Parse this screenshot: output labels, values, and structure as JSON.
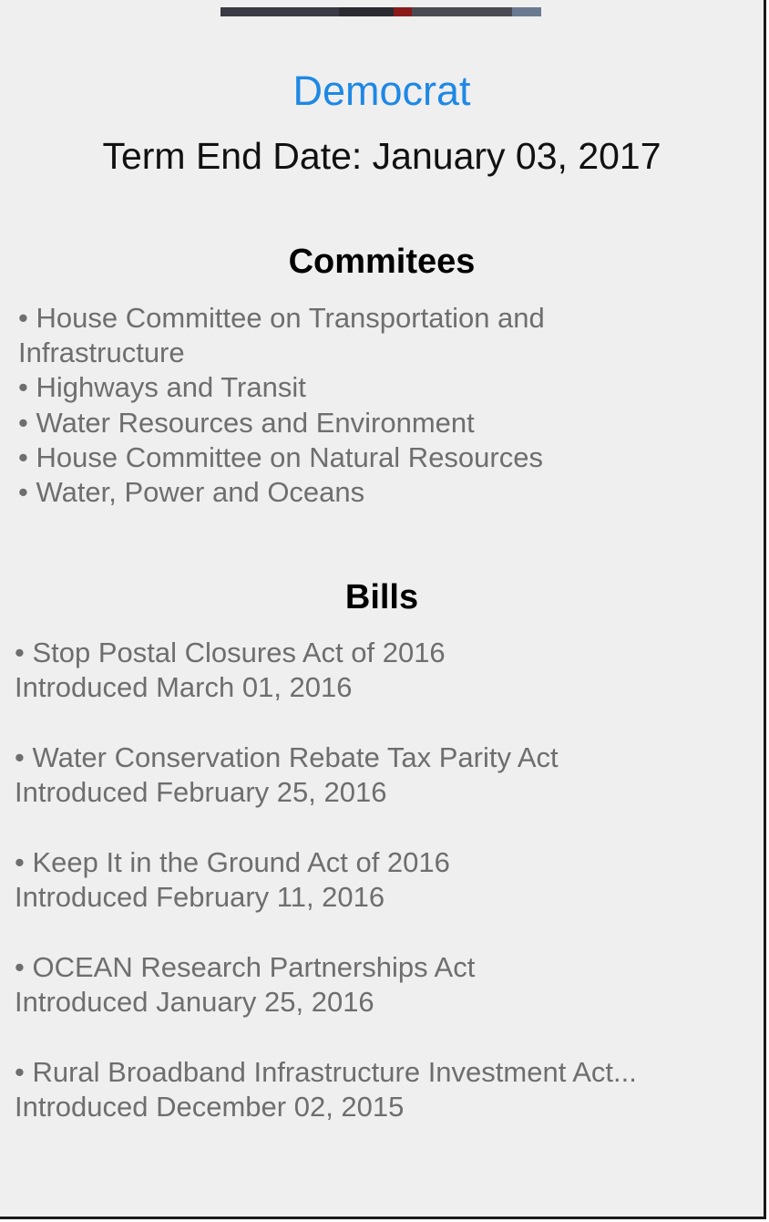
{
  "colors": {
    "party": "#1e88e5",
    "background": "#efefef",
    "text_secondary": "#6e6e6e"
  },
  "profile": {
    "party": "Democrat",
    "term_end": "Term End Date: January 03, 2017"
  },
  "committees": {
    "title": "Commitees",
    "items": [
      " • House Committee on Transportation and",
      "Infrastructure",
      " • Highways and Transit",
      " • Water Resources and Environment",
      " • House Committee on Natural Resources",
      " • Water, Power and Oceans"
    ]
  },
  "bills": {
    "title": "Bills",
    "items": [
      {
        "name": "• Stop Postal Closures Act of 2016",
        "introduced": "Introduced March 01, 2016"
      },
      {
        "name": "• Water Conservation Rebate Tax Parity Act",
        "introduced": "Introduced February 25, 2016"
      },
      {
        "name": "• Keep It in the Ground Act of 2016",
        "introduced": "Introduced February 11, 2016"
      },
      {
        "name": "• OCEAN Research Partnerships Act",
        "introduced": "Introduced January 25, 2016"
      },
      {
        "name": "• Rural Broadband Infrastructure Investment Act...",
        "introduced": "Introduced December 02, 2015"
      }
    ]
  }
}
